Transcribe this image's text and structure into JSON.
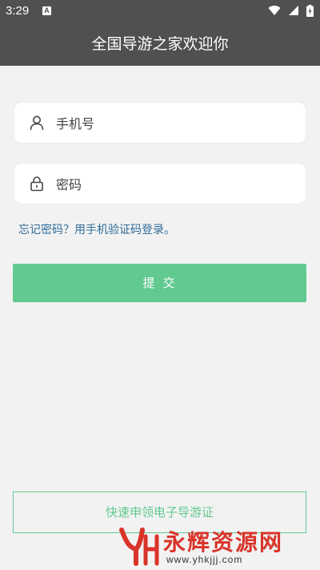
{
  "status_bar": {
    "time": "3:29",
    "notification_icon": "A",
    "icons": [
      "wifi-icon",
      "signal-icon",
      "battery-icon"
    ]
  },
  "header": {
    "title": "全国导游之家欢迎你"
  },
  "form": {
    "phone": {
      "placeholder": "手机号",
      "value": "",
      "icon": "user-icon"
    },
    "password": {
      "placeholder": "密码",
      "value": "",
      "icon": "lock-icon"
    },
    "forgot_link": "忘记密码？用手机验证码登录。",
    "submit_label": "提交"
  },
  "apply_button": "快速申领电子导游证",
  "watermark": {
    "name": "永辉资源网",
    "url": "www.yhkjjj.com"
  },
  "colors": {
    "header_bg": "#505050",
    "background": "#f2f2f2",
    "accent_green": "#62c991",
    "link_blue": "#2f6c99",
    "watermark_red": "#d9342a"
  }
}
